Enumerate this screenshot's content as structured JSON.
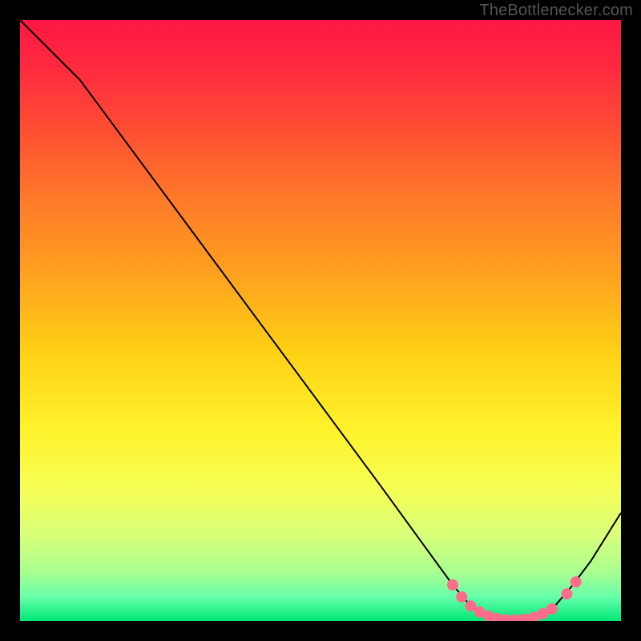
{
  "watermark": "TheBottlenecker.com",
  "chart_data": {
    "type": "line",
    "title": "",
    "xlabel": "",
    "ylabel": "",
    "xlim": [
      0,
      100
    ],
    "ylim": [
      0,
      100
    ],
    "background_gradient_stops": [
      {
        "offset": 0.0,
        "color": "#ff1744"
      },
      {
        "offset": 0.08,
        "color": "#ff2a3f"
      },
      {
        "offset": 0.18,
        "color": "#ff4d33"
      },
      {
        "offset": 0.3,
        "color": "#ff7a29"
      },
      {
        "offset": 0.42,
        "color": "#ffa01f"
      },
      {
        "offset": 0.55,
        "color": "#ffd014"
      },
      {
        "offset": 0.68,
        "color": "#fff22a"
      },
      {
        "offset": 0.78,
        "color": "#f6ff55"
      },
      {
        "offset": 0.86,
        "color": "#d6ff7a"
      },
      {
        "offset": 0.92,
        "color": "#a8ff90"
      },
      {
        "offset": 0.96,
        "color": "#66ffaa"
      },
      {
        "offset": 1.0,
        "color": "#00e676"
      }
    ],
    "curve": [
      {
        "x": 0,
        "y": 100
      },
      {
        "x": 3,
        "y": 97
      },
      {
        "x": 7,
        "y": 93
      },
      {
        "x": 10,
        "y": 90
      },
      {
        "x": 20,
        "y": 76.5
      },
      {
        "x": 30,
        "y": 63
      },
      {
        "x": 40,
        "y": 49.5
      },
      {
        "x": 50,
        "y": 36
      },
      {
        "x": 60,
        "y": 22.5
      },
      {
        "x": 68,
        "y": 11.5
      },
      {
        "x": 72,
        "y": 6
      },
      {
        "x": 75,
        "y": 2.5
      },
      {
        "x": 77,
        "y": 1
      },
      {
        "x": 80,
        "y": 0.2
      },
      {
        "x": 84,
        "y": 0.2
      },
      {
        "x": 87,
        "y": 1
      },
      {
        "x": 89,
        "y": 2.5
      },
      {
        "x": 92,
        "y": 6
      },
      {
        "x": 95,
        "y": 10
      },
      {
        "x": 100,
        "y": 18
      }
    ],
    "markers": [
      {
        "x": 72,
        "y": 6
      },
      {
        "x": 73.5,
        "y": 4
      },
      {
        "x": 75,
        "y": 2.5
      },
      {
        "x": 76.5,
        "y": 1.5
      },
      {
        "x": 78,
        "y": 0.8
      },
      {
        "x": 79.5,
        "y": 0.4
      },
      {
        "x": 81,
        "y": 0.2
      },
      {
        "x": 82.5,
        "y": 0.2
      },
      {
        "x": 84,
        "y": 0.3
      },
      {
        "x": 85.5,
        "y": 0.6
      },
      {
        "x": 87,
        "y": 1.2
      },
      {
        "x": 88.5,
        "y": 2
      },
      {
        "x": 91,
        "y": 4.5
      },
      {
        "x": 92.5,
        "y": 6.5
      }
    ],
    "marker_color": "#ff6b8a",
    "curve_color": "#000000"
  }
}
